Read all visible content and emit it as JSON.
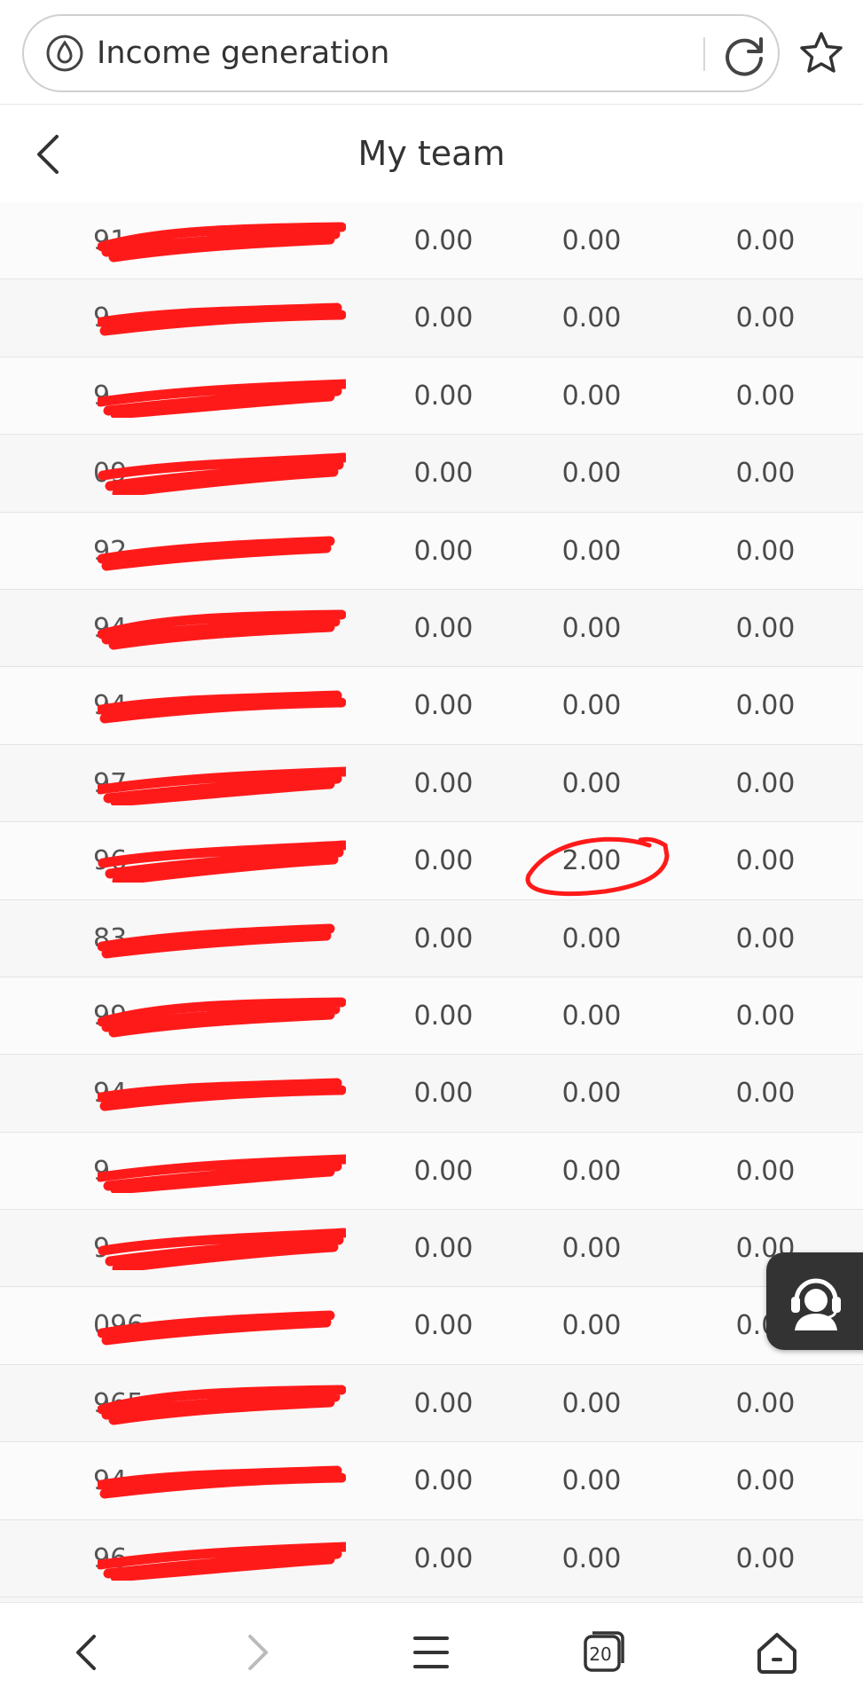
{
  "browser": {
    "url_text": "Income generation",
    "icons": {
      "site": "water-drop-icon",
      "reload": "reload-icon",
      "bookmark": "star-icon"
    }
  },
  "header": {
    "title": "My team",
    "back_icon": "chevron-left-icon"
  },
  "rows": [
    {
      "phone": "91",
      "v1": "0.00",
      "v2": "0.00",
      "v3": "0.00"
    },
    {
      "phone": "9",
      "v1": "0.00",
      "v2": "0.00",
      "v3": "0.00"
    },
    {
      "phone": "9",
      "v1": "0.00",
      "v2": "0.00",
      "v3": "0.00"
    },
    {
      "phone": "09",
      "v1": "0.00",
      "v2": "0.00",
      "v3": "0.00"
    },
    {
      "phone": "92",
      "v1": "0.00",
      "v2": "0.00",
      "v3": "0.00"
    },
    {
      "phone": "94",
      "v1": "0.00",
      "v2": "0.00",
      "v3": "0.00"
    },
    {
      "phone": "94",
      "v1": "0.00",
      "v2": "0.00",
      "v3": "0.00"
    },
    {
      "phone": "97",
      "v1": "0.00",
      "v2": "0.00",
      "v3": "0.00"
    },
    {
      "phone": "96",
      "v1": "0.00",
      "v2": "2.00",
      "v3": "0.00"
    },
    {
      "phone": "83",
      "v1": "0.00",
      "v2": "0.00",
      "v3": "0.00"
    },
    {
      "phone": "99",
      "v1": "0.00",
      "v2": "0.00",
      "v3": "0.00"
    },
    {
      "phone": "94",
      "v1": "0.00",
      "v2": "0.00",
      "v3": "0.00"
    },
    {
      "phone": "9",
      "v1": "0.00",
      "v2": "0.00",
      "v3": "0.00"
    },
    {
      "phone": "9",
      "v1": "0.00",
      "v2": "0.00",
      "v3": "0.00"
    },
    {
      "phone": "096",
      "v1": "0.00",
      "v2": "0.00",
      "v3": "0.00"
    },
    {
      "phone": "965",
      "v1": "0.00",
      "v2": "0.00",
      "v3": "0.00"
    },
    {
      "phone": "94",
      "v1": "0.00",
      "v2": "0.00",
      "v3": "0.00"
    },
    {
      "phone": "96",
      "v1": "0.00",
      "v2": "0.00",
      "v3": "0.00"
    }
  ],
  "support": {
    "icon": "customer-service-icon"
  },
  "bottom_nav": {
    "tab_count": "20",
    "icons": [
      "chevron-left-icon",
      "chevron-right-icon",
      "menu-icon",
      "tabs-icon",
      "home-icon"
    ]
  },
  "colors": {
    "redaction": "#ff1a1a",
    "background": "#f7f7f7",
    "support_button": "#333333"
  }
}
